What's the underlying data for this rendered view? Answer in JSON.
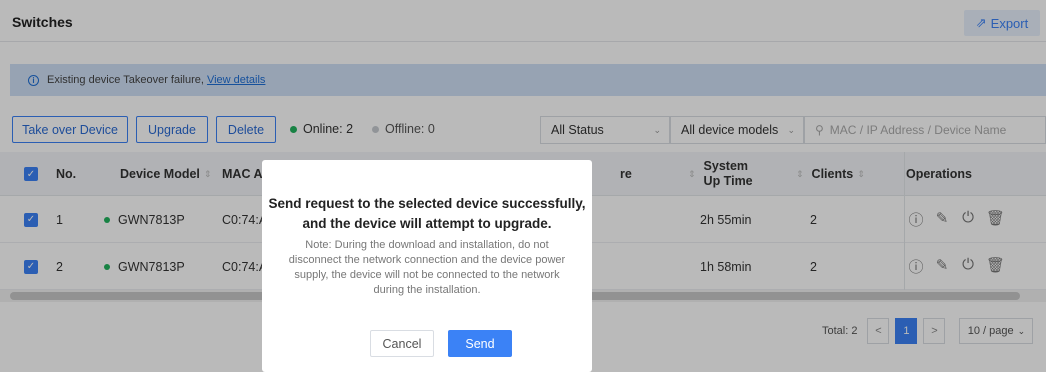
{
  "header": {
    "title": "Switches",
    "export_label": "Export"
  },
  "alert": {
    "text": "Existing device Takeover failure,",
    "link": "View details"
  },
  "toolbar": {
    "takeover_label": "Take over Device",
    "upgrade_label": "Upgrade",
    "delete_label": "Delete",
    "online_text": "Online: 2",
    "offline_text": "Offline: 0",
    "status_filter": "All Status",
    "model_filter": "All device models",
    "search_placeholder": "MAC / IP Address / Device Name",
    "online_color": "#22b35e",
    "offline_color": "#c7cbd1"
  },
  "table": {
    "columns": {
      "no": "No.",
      "model": "Device Model",
      "mac": "MAC Ad",
      "firmware": "re",
      "uptime": "System Up Time",
      "clients": "Clients",
      "operations": "Operations"
    },
    "rows": [
      {
        "no": "1",
        "model": "GWN7813P",
        "mac": "C0:74:A",
        "uptime": "2h 55min",
        "clients": "2"
      },
      {
        "no": "2",
        "model": "GWN7813P",
        "mac": "C0:74:A",
        "uptime": "1h 58min",
        "clients": "2"
      }
    ]
  },
  "pager": {
    "total": "Total: 2",
    "current_page": "1",
    "page_size": "10 / page"
  },
  "modal": {
    "title": "Send request to the selected device successfully, and the device will attempt to upgrade.",
    "note": "Note: During the download and installation, do not disconnect the network connection and the device power supply, the device will not be connected to the network during the installation.",
    "cancel_label": "Cancel",
    "send_label": "Send"
  }
}
